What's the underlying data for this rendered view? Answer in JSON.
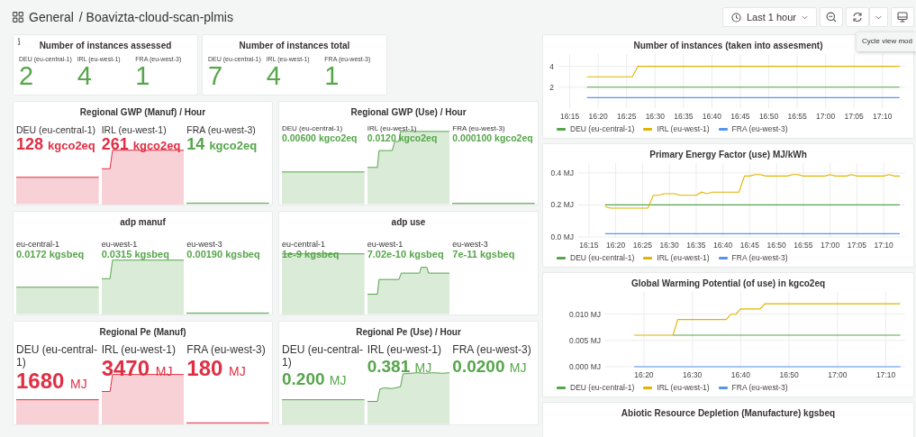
{
  "header": {
    "breadcrumb_root": "General",
    "breadcrumb_page": "/ Boavizta-cloud-scan-plmis"
  },
  "toolbar": {
    "time_range": "Last 1 hour"
  },
  "tooltip": "Cycle view mod",
  "stat_panels": [
    {
      "title": "Number of instances assessed",
      "info": true,
      "items": [
        {
          "label": "DEU (eu-central-1)",
          "value": "2"
        },
        {
          "label": "IRL (eu-west-1)",
          "value": "4"
        },
        {
          "label": "FRA (eu-west-3)",
          "value": "1"
        }
      ]
    },
    {
      "title": "Number of instances total",
      "info": false,
      "items": [
        {
          "label": "DEU (eu-central-1)",
          "value": "7"
        },
        {
          "label": "IRL (eu-west-1)",
          "value": "4"
        },
        {
          "label": "FRA (eu-west-3)",
          "value": "1"
        }
      ]
    }
  ],
  "sparkline_panels": [
    {
      "title": "Regional GWP (Manuf) / Hour",
      "items": [
        {
          "label": "DEU (eu-central-1)",
          "value": "128",
          "unit": "kgco2eq",
          "color": "#e02f44"
        },
        {
          "label": "IRL (eu-west-1)",
          "value": "261",
          "unit": "kgco2eq",
          "color": "#e02f44"
        },
        {
          "label": "FRA (eu-west-3)",
          "value": "14",
          "unit": "kgco2eq",
          "color": "#56a64b"
        }
      ]
    },
    {
      "title": "Regional GWP (Use) / Hour",
      "items": [
        {
          "label": "DEU (eu-central-1)",
          "value": "0.00600",
          "unit": "kgco2eq",
          "color": "#56a64b"
        },
        {
          "label": "IRL (eu-west-1)",
          "value": "0.0120",
          "unit": "kgco2eq",
          "color": "#56a64b"
        },
        {
          "label": "FRA (eu-west-3)",
          "value": "0.000100",
          "unit": "kgco2eq",
          "color": "#56a64b"
        }
      ]
    },
    {
      "title": "adp manuf",
      "items": [
        {
          "label": "eu-central-1",
          "value": "0.0172",
          "unit": "kgsbeq",
          "color": "#56a64b"
        },
        {
          "label": "eu-west-1",
          "value": "0.0315",
          "unit": "kgsbeq",
          "color": "#56a64b"
        },
        {
          "label": "eu-west-3",
          "value": "0.00190",
          "unit": "kgsbeq",
          "color": "#56a64b"
        }
      ]
    },
    {
      "title": "adp use",
      "items": [
        {
          "label": "eu-central-1",
          "value": "1e-9",
          "unit": "kgsbeq",
          "color": "#56a64b"
        },
        {
          "label": "eu-west-1",
          "value": "7.02e-10",
          "unit": "kgsbeq",
          "color": "#56a64b"
        },
        {
          "label": "eu-west-3",
          "value": "7e-11",
          "unit": "kgsbeq",
          "color": "#56a64b"
        }
      ]
    },
    {
      "title": "Regional Pe (Manuf)",
      "items": [
        {
          "label": "DEU (eu-central-1)",
          "value": "1680",
          "unit": "MJ",
          "color": "#e02f44"
        },
        {
          "label": "IRL (eu-west-1)",
          "value": "3470",
          "unit": "MJ",
          "color": "#e02f44"
        },
        {
          "label": "FRA (eu-west-3)",
          "value": "180",
          "unit": "MJ",
          "color": "#e02f44"
        }
      ]
    },
    {
      "title": "Regional Pe (Use) / Hour",
      "items": [
        {
          "label": "DEU (eu-central-1)",
          "value": "0.200",
          "unit": "MJ",
          "color": "#56a64b"
        },
        {
          "label": "IRL (eu-west-1)",
          "value": "0.381",
          "unit": "MJ",
          "color": "#56a64b"
        },
        {
          "label": "FRA (eu-west-3)",
          "value": "0.0200",
          "unit": "MJ",
          "color": "#56a64b"
        }
      ]
    }
  ],
  "chart_panels": [
    {
      "title": "Number of instances (taken into assesment)",
      "chart_data": {
        "type": "line",
        "grid": true,
        "legend": "bottom",
        "ylim": [
          0,
          5
        ],
        "categories": [
          null,
          null,
          "16:15",
          null,
          null,
          null,
          null,
          "16:20",
          null,
          null,
          null,
          null,
          "16:25",
          null,
          null,
          null,
          null,
          "16:30",
          null,
          null,
          null,
          null,
          "16:35",
          null,
          null,
          null,
          null,
          "16:40",
          null,
          null,
          null,
          null,
          "16:45",
          null,
          null,
          null,
          null,
          "16:50",
          null,
          null,
          null,
          null,
          "16:55",
          null,
          null,
          null,
          null,
          "17:00",
          null,
          null,
          null,
          null,
          "17:05",
          null,
          null,
          null,
          null,
          "17:10",
          null,
          null,
          null,
          null
        ],
        "yticks": [
          2,
          4
        ],
        "series": [
          {
            "name": "DEU (eu-central-1)",
            "color": "#56a64b",
            "values": [
              null,
              null,
              null,
              null,
              null,
              2,
              2,
              2,
              2,
              2,
              2,
              2,
              2,
              2,
              2,
              2,
              2,
              2,
              2,
              2,
              2,
              2,
              2,
              2,
              2,
              2,
              2,
              2,
              2,
              2,
              2,
              2,
              2,
              2,
              2,
              2,
              2,
              2,
              2,
              2,
              2,
              2,
              2,
              2,
              2,
              2,
              2,
              2,
              2,
              2,
              2,
              2,
              2,
              2,
              2,
              2,
              2,
              2,
              2,
              2,
              2,
              null
            ]
          },
          {
            "name": "IRL (eu-west-1)",
            "color": "#e0b400",
            "values": [
              null,
              null,
              null,
              null,
              null,
              3,
              3,
              3,
              3,
              3,
              3,
              3,
              3,
              3,
              4,
              4,
              4,
              4,
              4,
              4,
              4,
              4,
              4,
              4,
              4,
              4,
              4,
              4,
              4,
              4,
              4,
              4,
              4,
              4,
              4,
              4,
              4,
              4,
              4,
              4,
              4,
              4,
              4,
              4,
              4,
              4,
              4,
              4,
              4,
              4,
              4,
              4,
              4,
              4,
              4,
              4,
              4,
              4,
              4,
              4,
              4,
              null
            ]
          },
          {
            "name": "FRA (eu-west-3)",
            "color": "#5794f2",
            "values": [
              null,
              null,
              null,
              null,
              null,
              1,
              1,
              1,
              1,
              1,
              1,
              1,
              1,
              1,
              1,
              1,
              1,
              1,
              1,
              1,
              1,
              1,
              1,
              1,
              1,
              1,
              1,
              1,
              1,
              1,
              1,
              1,
              1,
              1,
              1,
              1,
              1,
              1,
              1,
              1,
              1,
              1,
              1,
              1,
              1,
              1,
              1,
              1,
              1,
              1,
              1,
              1,
              1,
              1,
              1,
              1,
              1,
              1,
              1,
              1,
              1,
              null
            ]
          }
        ]
      }
    },
    {
      "title": "Primary Energy Factor (use) MJ/kWh",
      "chart_data": {
        "type": "line",
        "grid": true,
        "legend": "bottom",
        "ylim": [
          0,
          0.45
        ],
        "categories": [
          null,
          null,
          "16:15",
          null,
          null,
          null,
          null,
          "16:20",
          null,
          null,
          null,
          null,
          "16:25",
          null,
          null,
          null,
          null,
          "16:30",
          null,
          null,
          null,
          null,
          "16:35",
          null,
          null,
          null,
          null,
          "16:40",
          null,
          null,
          null,
          null,
          "16:45",
          null,
          null,
          null,
          null,
          "16:50",
          null,
          null,
          null,
          null,
          "16:55",
          null,
          null,
          null,
          null,
          "17:00",
          null,
          null,
          null,
          null,
          "17:05",
          null,
          null,
          null,
          null,
          "17:10",
          null,
          null,
          null,
          null
        ],
        "yticks": [
          {
            "value": 0,
            "label": "0.0 MJ"
          },
          {
            "value": 0.2,
            "label": "0.2 MJ"
          },
          {
            "value": 0.4,
            "label": "0.4 MJ"
          }
        ],
        "series": [
          {
            "name": "DEU (eu-central-1)",
            "color": "#56a64b",
            "values": [
              null,
              null,
              null,
              null,
              null,
              0.2,
              0.2,
              0.2,
              0.2,
              0.2,
              0.2,
              0.2,
              0.2,
              0.2,
              0.2,
              0.2,
              0.2,
              0.2,
              0.2,
              0.2,
              0.2,
              0.2,
              0.2,
              0.2,
              0.2,
              0.2,
              0.2,
              0.2,
              0.2,
              0.2,
              0.2,
              0.2,
              0.2,
              0.2,
              0.2,
              0.2,
              0.2,
              0.2,
              0.2,
              0.2,
              0.2,
              0.2,
              0.2,
              0.2,
              0.2,
              0.2,
              0.2,
              0.2,
              0.2,
              0.2,
              0.2,
              0.2,
              0.2,
              0.2,
              0.2,
              0.2,
              0.2,
              0.2,
              0.2,
              0.2,
              0.2,
              null
            ]
          },
          {
            "name": "IRL (eu-west-1)",
            "color": "#e0b400",
            "values": [
              null,
              null,
              null,
              null,
              null,
              0.19,
              0.18,
              0.18,
              0.18,
              0.18,
              0.18,
              0.18,
              0.18,
              0.18,
              0.26,
              0.26,
              0.27,
              0.27,
              0.27,
              0.26,
              0.26,
              0.26,
              0.26,
              0.28,
              0.27,
              0.28,
              0.28,
              0.28,
              0.28,
              0.28,
              0.28,
              0.38,
              0.38,
              0.39,
              0.39,
              0.38,
              0.38,
              0.38,
              0.38,
              0.38,
              0.39,
              0.39,
              0.38,
              0.38,
              0.38,
              0.38,
              0.38,
              0.39,
              0.38,
              0.38,
              0.38,
              0.39,
              0.38,
              0.38,
              0.38,
              0.38,
              0.38,
              0.38,
              0.39,
              0.38,
              0.38,
              null
            ]
          },
          {
            "name": "FRA (eu-west-3)",
            "color": "#5794f2",
            "values": [
              null,
              null,
              null,
              null,
              null,
              0.02,
              0.02,
              0.02,
              0.02,
              0.02,
              0.02,
              0.02,
              0.02,
              0.02,
              0.02,
              0.02,
              0.02,
              0.02,
              0.02,
              0.02,
              0.02,
              0.02,
              0.02,
              0.02,
              0.02,
              0.02,
              0.02,
              0.02,
              0.02,
              0.02,
              0.02,
              0.02,
              0.02,
              0.02,
              0.02,
              0.02,
              0.02,
              0.02,
              0.02,
              0.02,
              0.02,
              0.02,
              0.02,
              0.02,
              0.02,
              0.02,
              0.02,
              0.02,
              0.02,
              0.02,
              0.02,
              0.02,
              0.02,
              0.02,
              0.02,
              0.02,
              0.02,
              0.02,
              0.02,
              0.02,
              0.02,
              null
            ]
          }
        ]
      }
    },
    {
      "title": "Global Warming Potential (of use) in kgco2eq",
      "chart_data": {
        "type": "line",
        "grid": true,
        "legend": "bottom",
        "ylim": [
          0,
          0.0139
        ],
        "categories": [
          null,
          null,
          null,
          null,
          null,
          null,
          null,
          null,
          "16:20",
          null,
          null,
          null,
          null,
          null,
          null,
          null,
          null,
          null,
          "16:30",
          null,
          null,
          null,
          null,
          null,
          null,
          null,
          null,
          null,
          "16:40",
          null,
          null,
          null,
          null,
          null,
          null,
          null,
          null,
          null,
          "16:50",
          null,
          null,
          null,
          null,
          null,
          null,
          null,
          null,
          null,
          "17:00",
          null,
          null,
          null,
          null,
          null,
          null,
          null,
          null,
          null,
          "17:10",
          null,
          null,
          null,
          null
        ],
        "yticks": [
          {
            "value": 0,
            "label": "0.000 MJ"
          },
          {
            "value": 0.005,
            "label": "0.005 MJ"
          },
          {
            "value": 0.01,
            "label": "0.010 MJ"
          }
        ],
        "series": [
          {
            "name": "DEU (eu-central-1)",
            "color": "#56a64b",
            "values": [
              null,
              null,
              null,
              null,
              null,
              null,
              null,
              null,
              null,
              null,
              null,
              null,
              null,
              null,
              0.006,
              0.006,
              0.006,
              0.006,
              0.006,
              0.006,
              0.006,
              0.006,
              0.006,
              0.006,
              0.006,
              0.006,
              0.006,
              0.006,
              0.006,
              0.006,
              0.006,
              0.006,
              0.006,
              0.006,
              0.006,
              0.006,
              0.006,
              0.006,
              0.006,
              0.006,
              0.006,
              0.006,
              0.006,
              0.006,
              0.006,
              0.006,
              0.006,
              0.006,
              0.006,
              0.006,
              0.006,
              0.006,
              0.006,
              0.006,
              0.006,
              0.006,
              0.006,
              0.006,
              0.006,
              0.006,
              0.006,
              0.006,
              null
            ]
          },
          {
            "name": "IRL (eu-west-1)",
            "color": "#e0b400",
            "values": [
              null,
              null,
              null,
              null,
              null,
              null,
              0.006,
              0.006,
              0.006,
              0.006,
              0.006,
              0.006,
              0.006,
              0.006,
              0.006,
              0.009,
              0.009,
              0.009,
              0.009,
              0.009,
              0.009,
              0.009,
              0.009,
              0.009,
              0.009,
              0.009,
              0.01,
              0.01,
              0.011,
              0.011,
              0.011,
              0.011,
              0.011,
              0.012,
              0.012,
              0.012,
              0.012,
              0.012,
              0.012,
              0.012,
              0.012,
              0.012,
              0.012,
              0.012,
              0.012,
              0.012,
              0.012,
              0.012,
              0.012,
              0.012,
              0.012,
              0.012,
              0.012,
              0.012,
              0.012,
              0.012,
              0.012,
              0.012,
              0.012,
              0.012,
              0.012,
              0.012,
              null
            ]
          },
          {
            "name": "FRA (eu-west-3)",
            "color": "#5794f2",
            "values": [
              null,
              null,
              null,
              null,
              null,
              null,
              0,
              0,
              0,
              0,
              0,
              0,
              0,
              0,
              0,
              0,
              0,
              0,
              0,
              0,
              0,
              0,
              0,
              0,
              0,
              0,
              0,
              0,
              0,
              0,
              0,
              0,
              0,
              0,
              0,
              0,
              0,
              0,
              0,
              0,
              0,
              0,
              0,
              0,
              0,
              0,
              0,
              0,
              0,
              0,
              0,
              0,
              0,
              0,
              0,
              0,
              0,
              0,
              0,
              0,
              0,
              0,
              null
            ]
          }
        ]
      }
    },
    {
      "title": "Abiotic Resource Depletion (Manufacture) kgsbeq"
    }
  ]
}
